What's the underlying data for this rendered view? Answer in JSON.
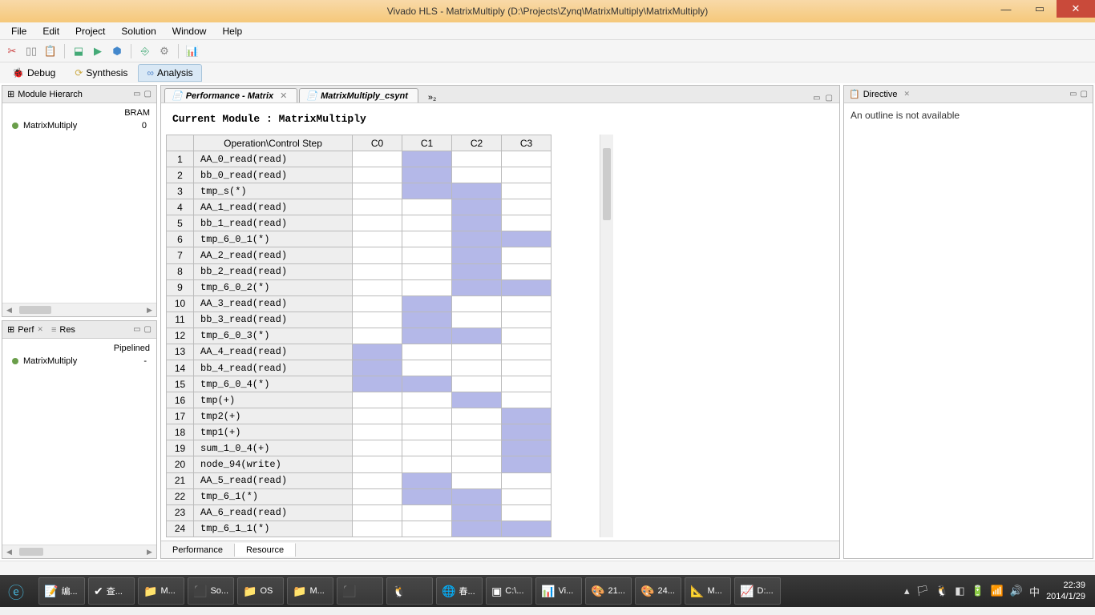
{
  "title": "Vivado HLS - MatrixMultiply (D:\\Projects\\Zynq\\MatrixMultiply\\MatrixMultiply)",
  "menu": {
    "file": "File",
    "edit": "Edit",
    "project": "Project",
    "solution": "Solution",
    "window": "Window",
    "help": "Help"
  },
  "persp": {
    "debug": "Debug",
    "synth": "Synthesis",
    "analy": "Analysis"
  },
  "panel": {
    "hier_title": "Module Hierarch",
    "hier_col": "BRAM",
    "hier_item": "MatrixMultiply",
    "hier_val": "0",
    "perf_tab": "Perf",
    "res_tab": "Res",
    "perf_col": "Pipelined",
    "perf_item": "MatrixMultiply",
    "perf_val": "-",
    "directive_title": "Directive",
    "directive_body": "An outline is not available"
  },
  "editor": {
    "tab1": "Performance - Matrix",
    "tab2": "MatrixMultiply_csynt",
    "more": "»₂",
    "module_line": "Current Module : MatrixMultiply",
    "cols": {
      "op": "Operation\\Control Step",
      "c0": "C0",
      "c1": "C1",
      "c2": "C2",
      "c3": "C3"
    },
    "rows": [
      {
        "n": "1",
        "op": "AA_0_read(read)",
        "c": [
          0,
          1,
          0,
          0
        ]
      },
      {
        "n": "2",
        "op": "bb_0_read(read)",
        "c": [
          0,
          1,
          0,
          0
        ]
      },
      {
        "n": "3",
        "op": "tmp_s(*)",
        "c": [
          0,
          1,
          1,
          0
        ]
      },
      {
        "n": "4",
        "op": "AA_1_read(read)",
        "c": [
          0,
          0,
          1,
          0
        ]
      },
      {
        "n": "5",
        "op": "bb_1_read(read)",
        "c": [
          0,
          0,
          1,
          0
        ]
      },
      {
        "n": "6",
        "op": "tmp_6_0_1(*)",
        "c": [
          0,
          0,
          1,
          1
        ]
      },
      {
        "n": "7",
        "op": "AA_2_read(read)",
        "c": [
          0,
          0,
          1,
          0
        ]
      },
      {
        "n": "8",
        "op": "bb_2_read(read)",
        "c": [
          0,
          0,
          1,
          0
        ]
      },
      {
        "n": "9",
        "op": "tmp_6_0_2(*)",
        "c": [
          0,
          0,
          1,
          1
        ]
      },
      {
        "n": "10",
        "op": "AA_3_read(read)",
        "c": [
          0,
          1,
          0,
          0
        ]
      },
      {
        "n": "11",
        "op": "bb_3_read(read)",
        "c": [
          0,
          1,
          0,
          0
        ]
      },
      {
        "n": "12",
        "op": "tmp_6_0_3(*)",
        "c": [
          0,
          1,
          1,
          0
        ]
      },
      {
        "n": "13",
        "op": "AA_4_read(read)",
        "c": [
          1,
          0,
          0,
          0
        ]
      },
      {
        "n": "14",
        "op": "bb_4_read(read)",
        "c": [
          1,
          0,
          0,
          0
        ]
      },
      {
        "n": "15",
        "op": "tmp_6_0_4(*)",
        "c": [
          1,
          1,
          0,
          0
        ]
      },
      {
        "n": "16",
        "op": "tmp(+)",
        "c": [
          0,
          0,
          1,
          0
        ]
      },
      {
        "n": "17",
        "op": "tmp2(+)",
        "c": [
          0,
          0,
          0,
          1
        ]
      },
      {
        "n": "18",
        "op": "tmp1(+)",
        "c": [
          0,
          0,
          0,
          1
        ]
      },
      {
        "n": "19",
        "op": "sum_1_0_4(+)",
        "c": [
          0,
          0,
          0,
          1
        ]
      },
      {
        "n": "20",
        "op": "node_94(write)",
        "c": [
          0,
          0,
          0,
          1
        ]
      },
      {
        "n": "21",
        "op": "AA_5_read(read)",
        "c": [
          0,
          1,
          0,
          0
        ]
      },
      {
        "n": "22",
        "op": "tmp_6_1(*)",
        "c": [
          0,
          1,
          1,
          0
        ]
      },
      {
        "n": "23",
        "op": "AA_6_read(read)",
        "c": [
          0,
          0,
          1,
          0
        ]
      },
      {
        "n": "24",
        "op": "tmp_6_1_1(*)",
        "c": [
          0,
          0,
          1,
          1
        ]
      }
    ],
    "bottom_tab1": "Performance",
    "bottom_tab2": "Resource"
  },
  "taskbar": {
    "items": [
      "编...",
      "查...",
      "M...",
      "So...",
      "OS",
      "M...",
      "",
      "",
      "春...",
      "C:\\...",
      "Vi...",
      "21...",
      "24...",
      "M...",
      "D:..."
    ],
    "time": "22:39",
    "date": "2014/1/29"
  }
}
